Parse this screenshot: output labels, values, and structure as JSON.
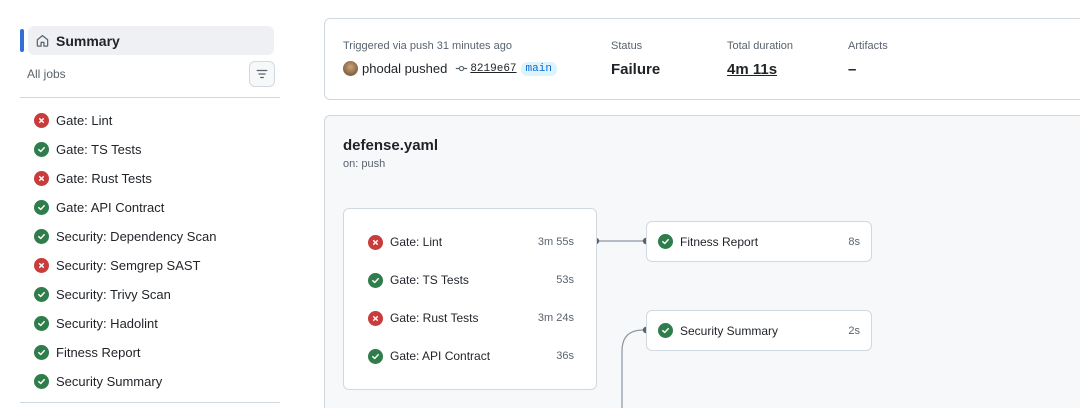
{
  "sidebar": {
    "summary_label": "Summary",
    "all_jobs_label": "All jobs",
    "jobs": [
      {
        "label": "Gate: Lint",
        "status": "failure"
      },
      {
        "label": "Gate: TS Tests",
        "status": "success"
      },
      {
        "label": "Gate: Rust Tests",
        "status": "failure"
      },
      {
        "label": "Gate: API Contract",
        "status": "success"
      },
      {
        "label": "Security: Dependency Scan",
        "status": "success"
      },
      {
        "label": "Security: Semgrep SAST",
        "status": "failure"
      },
      {
        "label": "Security: Trivy Scan",
        "status": "success"
      },
      {
        "label": "Security: Hadolint",
        "status": "success"
      },
      {
        "label": "Fitness Report",
        "status": "success"
      },
      {
        "label": "Security Summary",
        "status": "success"
      }
    ]
  },
  "run_info": {
    "trigger_label": "Triggered via push 31 minutes ago",
    "actor_text": "phodal pushed",
    "commit_sha": "8219e67",
    "branch": "main",
    "status_label": "Status",
    "status_value": "Failure",
    "duration_label": "Total duration",
    "duration_value": "4m 11s",
    "artifacts_label": "Artifacts",
    "artifacts_value": "–"
  },
  "workflow": {
    "file_name": "defense.yaml",
    "trigger": "on: push",
    "gate_jobs": [
      {
        "label": "Gate: Lint",
        "duration": "3m 55s",
        "status": "failure"
      },
      {
        "label": "Gate: TS Tests",
        "duration": "53s",
        "status": "success"
      },
      {
        "label": "Gate: Rust Tests",
        "duration": "3m 24s",
        "status": "failure"
      },
      {
        "label": "Gate: API Contract",
        "duration": "36s",
        "status": "success"
      }
    ],
    "fitness_report": {
      "label": "Fitness Report",
      "duration": "8s",
      "status": "success"
    },
    "security_summary": {
      "label": "Security Summary",
      "duration": "2s",
      "status": "success"
    }
  },
  "colors": {
    "success": "#2e7d4a",
    "failure": "#c93c3c",
    "accent": "#2f6fd6",
    "branch_text": "#0969da"
  },
  "icons": [
    "home-icon",
    "filter-icon",
    "check-circle-icon",
    "x-circle-icon",
    "commit-icon",
    "avatar"
  ]
}
